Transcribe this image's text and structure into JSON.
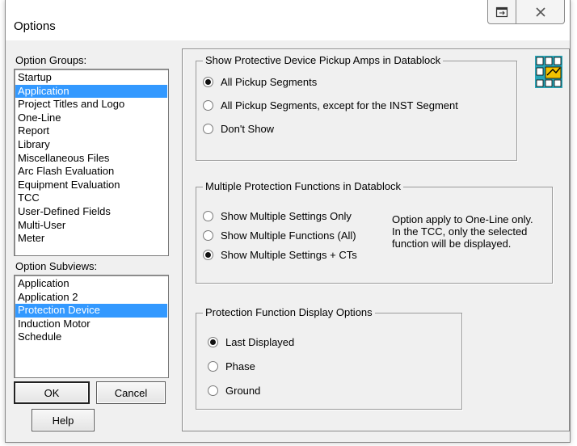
{
  "window": {
    "title": "Options"
  },
  "titlebar": {
    "restore_icon": "restore-icon",
    "close_icon": "close-icon"
  },
  "left": {
    "groups_label": "Option Groups:",
    "groups": [
      {
        "label": "Startup",
        "selected": false
      },
      {
        "label": "Application",
        "selected": true
      },
      {
        "label": "Project Titles and Logo",
        "selected": false
      },
      {
        "label": "One-Line",
        "selected": false
      },
      {
        "label": "Report",
        "selected": false
      },
      {
        "label": "Library",
        "selected": false
      },
      {
        "label": "Miscellaneous Files",
        "selected": false
      },
      {
        "label": "Arc Flash Evaluation",
        "selected": false
      },
      {
        "label": "Equipment Evaluation",
        "selected": false
      },
      {
        "label": "TCC",
        "selected": false
      },
      {
        "label": "User-Defined Fields",
        "selected": false
      },
      {
        "label": "Multi-User",
        "selected": false
      },
      {
        "label": "Meter",
        "selected": false
      }
    ],
    "subviews_label": "Option Subviews:",
    "subviews": [
      {
        "label": "Application",
        "selected": false
      },
      {
        "label": "Application 2",
        "selected": false
      },
      {
        "label": "Protection Device",
        "selected": true
      },
      {
        "label": "Induction Motor",
        "selected": false
      },
      {
        "label": "Schedule",
        "selected": false
      }
    ],
    "ok_label": "OK",
    "cancel_label": "Cancel",
    "help_label": "Help"
  },
  "pickup": {
    "title": "Show Protective Device Pickup Amps in Datablock",
    "options": [
      {
        "label": "All Pickup Segments",
        "checked": true
      },
      {
        "label": "All Pickup Segments, except for the INST Segment",
        "checked": false
      },
      {
        "label": "Don't Show",
        "checked": false
      }
    ]
  },
  "multi": {
    "title": "Multiple Protection Functions in Datablock",
    "options": [
      {
        "label": "Show Multiple Settings Only",
        "checked": false
      },
      {
        "label": "Show Multiple Functions (All)",
        "checked": false
      },
      {
        "label": "Show Multiple Settings + CTs",
        "checked": true
      }
    ],
    "note_lines": [
      "Option apply to One-Line only.",
      "In the TCC, only the selected",
      "function will be displayed."
    ]
  },
  "display": {
    "title": "Protection Function Display Options",
    "options": [
      {
        "label": "Last Displayed",
        "checked": true
      },
      {
        "label": "Phase",
        "checked": false
      },
      {
        "label": "Ground",
        "checked": false
      }
    ]
  },
  "icon": {
    "name": "protection-device-icon"
  }
}
